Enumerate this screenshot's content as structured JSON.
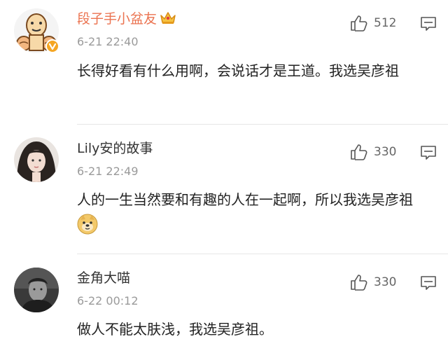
{
  "comments": [
    {
      "username": "段子手小盆友",
      "user_style": "vip",
      "avatar_icon": "cartoon-face-avatar",
      "verified_badge_icon": "verified-v-badge-icon",
      "vip_icon": "crown-vip-icon",
      "time": "6-21 22:40",
      "text": "长得好看有什么用啊，会说话才是王道。我选吴彦祖",
      "likes": "512"
    },
    {
      "username": "Lily安的故事",
      "user_style": "normal",
      "avatar_icon": "girl-photo-avatar",
      "time": "6-21 22:49",
      "text": "人的一生当然要和有趣的人在一起啊，所以我选吴彦祖",
      "emoji_icon": "doge-emoji-icon",
      "likes": "330"
    },
    {
      "username": "金角大喵",
      "user_style": "normal",
      "avatar_icon": "man-photo-avatar",
      "time": "6-22 00:12",
      "text": "做人不能太肤浅，我选吴彦祖。",
      "likes": "330"
    }
  ],
  "icons": {
    "like": "thumbs-up-icon",
    "reply": "comment-bubble-icon"
  },
  "colors": {
    "vip_name": "#eb7350",
    "normal_name": "#333333",
    "time": "#9a9a9a",
    "divider": "#e6e6e6",
    "badge": "#f5a623"
  }
}
